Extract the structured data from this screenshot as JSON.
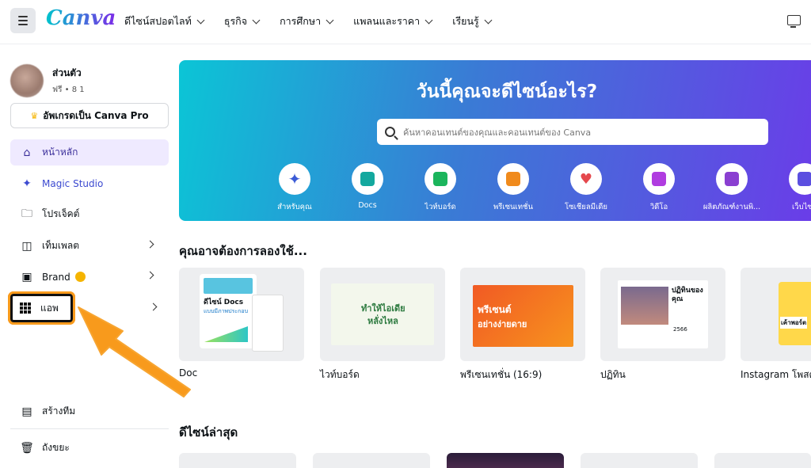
{
  "topbar": {
    "logo": "Canva",
    "nav": [
      "ดีไซน์สปอตไลท์",
      "ธุรกิจ",
      "การศึกษา",
      "แพลนและราคา",
      "เรียนรู้"
    ]
  },
  "account": {
    "name": "ส่วนตัว",
    "sub": "ฟรี • 8 1"
  },
  "upgrade_label": "อัพเกรดเป็น Canva Pro",
  "sidebar": {
    "items": [
      {
        "label": "หน้าหลัก"
      },
      {
        "label": "Magic Studio"
      },
      {
        "label": "โปรเจ็คต์"
      },
      {
        "label": "เท็มเพลต"
      },
      {
        "label": "Brand"
      },
      {
        "label": "แอพ"
      },
      {
        "label": "สร้างทีม"
      },
      {
        "label": "ถังขยะ"
      }
    ]
  },
  "hero": {
    "title": "วันนี้คุณจะดีไซน์อะไร?",
    "search_placeholder": "ค้นหาคอนเทนต์ของคุณและคอนเทนต์ของ Canva",
    "categories": [
      {
        "label": "สำหรับคุณ",
        "icon": "sparkle-icon",
        "color": "#3b5bd6"
      },
      {
        "label": "Docs",
        "icon": "doc-icon",
        "color": "#13a89e"
      },
      {
        "label": "ไวท์บอร์ด",
        "icon": "whiteboard-icon",
        "color": "#1bb55c"
      },
      {
        "label": "พรีเซนเทชั่น",
        "icon": "presentation-icon",
        "color": "#f08a1c"
      },
      {
        "label": "โซเชียลมีเดีย",
        "icon": "heart-icon",
        "color": "#e5484d"
      },
      {
        "label": "วิดีโอ",
        "icon": "video-icon",
        "color": "#b03ce0"
      },
      {
        "label": "ผลิตภัณฑ์งานพิ...",
        "icon": "printer-icon",
        "color": "#8a3fd1"
      },
      {
        "label": "เว็บไซต์",
        "icon": "website-icon",
        "color": "#5b4fe0"
      }
    ]
  },
  "section_try": "คุณอาจต้องการลองใช้...",
  "cards": [
    {
      "label": "Doc",
      "heading": "ดีไซน์ Docs",
      "sub": "แบบมีภาพประกอบ"
    },
    {
      "label": "ไวท์บอร์ด",
      "heading": "ทำให้ไอเดีย",
      "sub": "หลั่งไหล"
    },
    {
      "label": "พรีเซนเทชั่น (16:9)",
      "heading": "พรีเซนต์",
      "sub": "อย่างง่ายดาย"
    },
    {
      "label": "ปฏิทิน",
      "heading": "ปฏิทินของคุณ",
      "sub": "2566"
    },
    {
      "label": "Instagram โพสต์",
      "heading": "เค้าพอร์ต",
      "sub": ""
    }
  ],
  "section_recent": "ดีไซน์ล่าสุด",
  "colors": {
    "accent": "#7d2ae8",
    "highlight": "#f89a1c"
  }
}
